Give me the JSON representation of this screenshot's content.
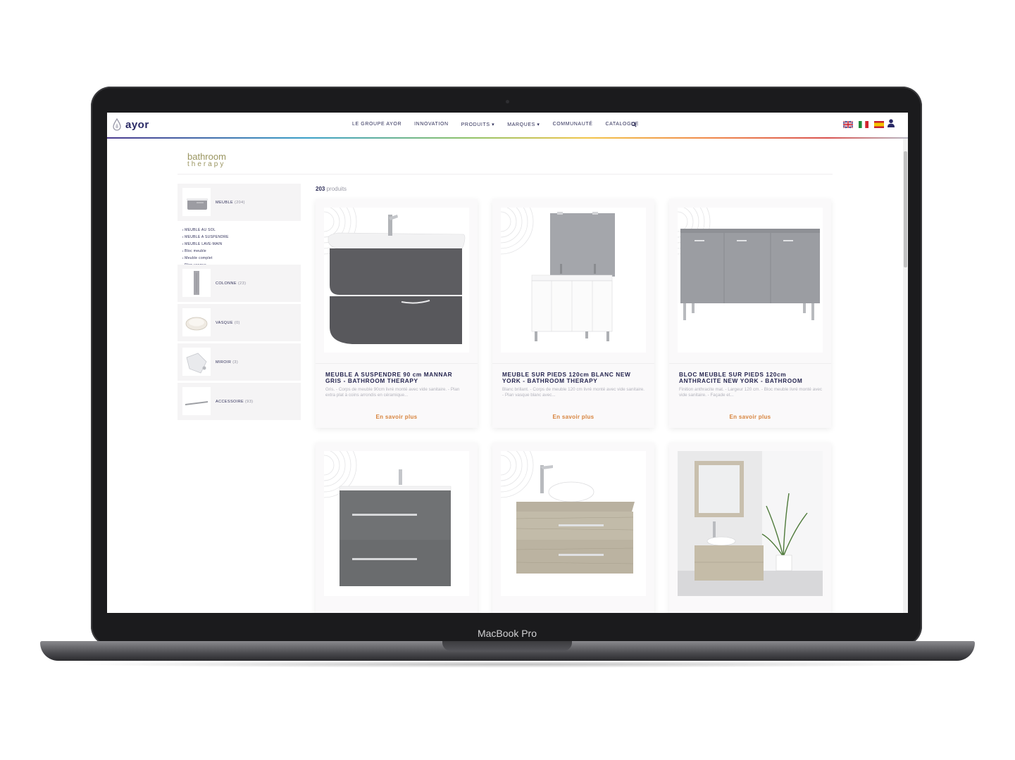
{
  "device": {
    "label": "MacBook Pro"
  },
  "site": {
    "logo_text": "ayor",
    "nav": [
      "LE GROUPE AYOR",
      "INNOVATION",
      "PRODUITS ▾",
      "MARQUES ▾",
      "COMMUNAUTÉ",
      "CATALOGUE"
    ],
    "languages": [
      "uk-flag-icon",
      "italy-flag-icon",
      "spain-flag-icon"
    ]
  },
  "brand": {
    "line1": "bathroom",
    "line2": "therapy"
  },
  "sidebar": {
    "categories": [
      {
        "label": "MEUBLE",
        "count": "(204)"
      },
      {
        "label": "COLONNE",
        "count": "(23)"
      },
      {
        "label": "VASQUE",
        "count": "(0)"
      },
      {
        "label": "MIROIR",
        "count": "(3)"
      },
      {
        "label": "ACCESSOIRE",
        "count": "(93)"
      }
    ],
    "subcategories": [
      "MEUBLE AU SOL",
      "MEUBLE A SUSPENDRE",
      "MEUBLE LAVE-MAIN",
      "Bloc meuble",
      "Meuble complet",
      "Plan vasque"
    ]
  },
  "results": {
    "count": "203",
    "suffix": "produits"
  },
  "products": [
    {
      "title": "MEUBLE A SUSPENDRE 90 cm MANNAR GRIS - BATHROOM THERAPY",
      "desc": "Gris. - Corps de meuble 90cm livré monté avec vide sanitaire. - Plan extra plat à coins arrondis en céramique...",
      "link": "En savoir plus"
    },
    {
      "title": "MEUBLE SUR PIEDS 120cm BLANC NEW YORK - BATHROOM THERAPY",
      "desc": "Blanc brillant. - Corps de meuble 120 cm livré monté avec vide sanitaire. - Plan vasque blanc avec...",
      "link": "En savoir plus"
    },
    {
      "title": "BLOC MEUBLE SUR PIEDS 120cm ANTHRACITE NEW YORK - BATHROOM",
      "desc": "Finition anthracite mat. - Largeur 120 cm. - Bloc meuble livré monté avec vide sanitaire. - Façade et...",
      "link": "En savoir plus"
    }
  ],
  "colors": {
    "accent": "#d7833c",
    "navy": "#25254f",
    "olive": "#9a9560"
  }
}
